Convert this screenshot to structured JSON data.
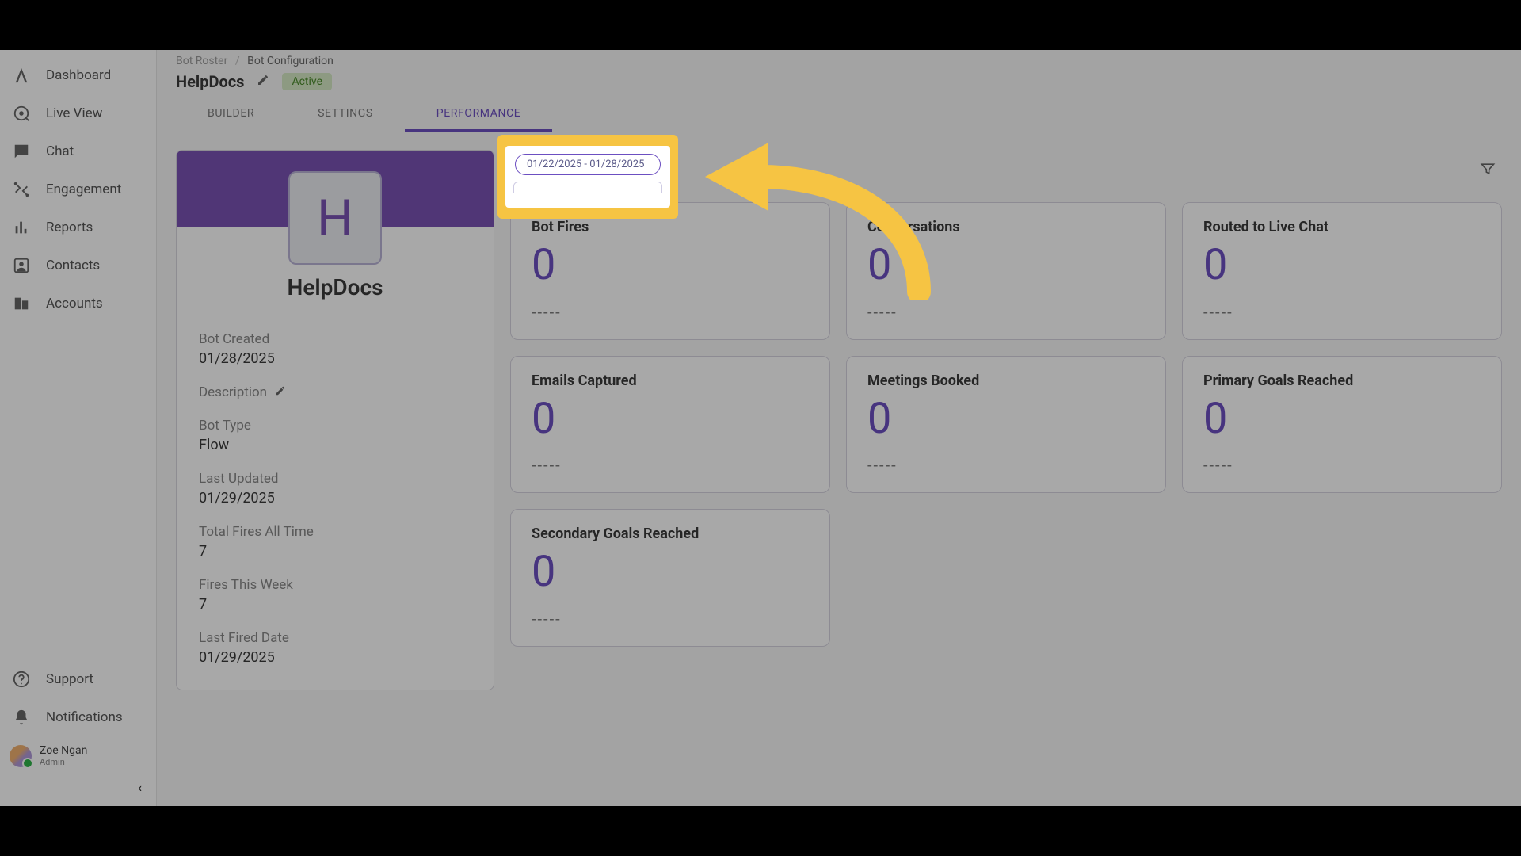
{
  "sidebar": {
    "items": [
      {
        "label": "Dashboard",
        "icon": "logo-icon"
      },
      {
        "label": "Live View",
        "icon": "liveview-icon"
      },
      {
        "label": "Chat",
        "icon": "chat-icon"
      },
      {
        "label": "Engagement",
        "icon": "engagement-icon"
      },
      {
        "label": "Reports",
        "icon": "reports-icon"
      },
      {
        "label": "Contacts",
        "icon": "contacts-icon"
      },
      {
        "label": "Accounts",
        "icon": "accounts-icon"
      }
    ],
    "bottom": [
      {
        "label": "Support",
        "icon": "support-icon"
      },
      {
        "label": "Notifications",
        "icon": "notifications-icon"
      }
    ],
    "user": {
      "name": "Zoe Ngan",
      "role": "Admin"
    }
  },
  "breadcrumb": {
    "root": "Bot Roster",
    "current": "Bot Configuration"
  },
  "title": {
    "name": "HelpDocs",
    "status": "Active"
  },
  "tabs": {
    "builder": "BUILDER",
    "settings": "SETTINGS",
    "performance": "PERFORMANCE",
    "active": "performance"
  },
  "date_range": "01/22/2025 - 01/28/2025",
  "bot": {
    "avatar_letter": "H",
    "name": "HelpDocs",
    "fields": {
      "created_label": "Bot Created",
      "created": "01/28/2025",
      "description_label": "Description",
      "type_label": "Bot Type",
      "type": "Flow",
      "updated_label": "Last Updated",
      "updated": "01/29/2025",
      "total_label ": "",
      "total_fires_label": "Total Fires All Time",
      "total_fires": "7",
      "fires_week_label": "Fires This Week",
      "fires_week": "7",
      "last_fired_label": "Last Fired Date",
      "last_fired": "01/29/2025"
    }
  },
  "metrics": {
    "row1": [
      {
        "title": "Bot Fires",
        "value": "0",
        "trend": "-----"
      },
      {
        "title": "Conversations",
        "value": "0",
        "trend": "-----"
      },
      {
        "title": "Routed to Live Chat",
        "value": "0",
        "trend": "-----"
      }
    ],
    "row2": [
      {
        "title": "Emails Captured",
        "value": "0",
        "trend": "-----"
      },
      {
        "title": "Meetings Booked",
        "value": "0",
        "trend": "-----"
      },
      {
        "title": "Primary Goals Reached",
        "value": "0",
        "trend": "-----"
      }
    ],
    "secondary": {
      "title": "Secondary Goals Reached",
      "value": "0",
      "trend": "-----"
    }
  }
}
